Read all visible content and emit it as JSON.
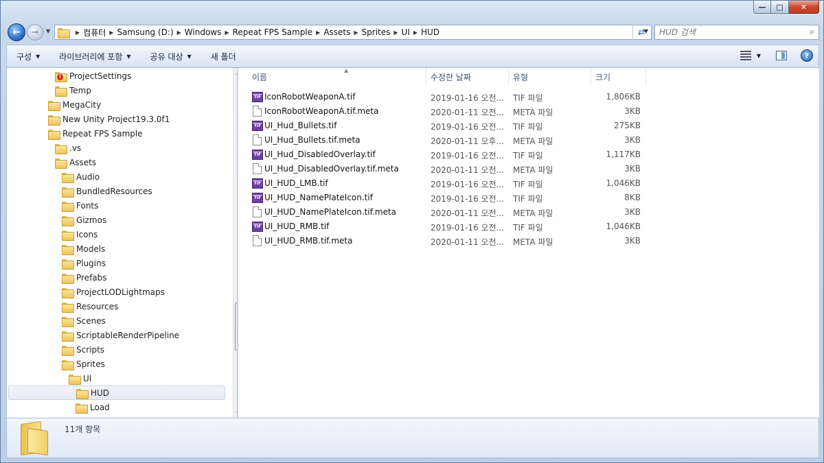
{
  "window": {
    "minimize": "—",
    "maximize": "□",
    "close": "✕"
  },
  "address": {
    "crumbs": [
      "컴퓨터",
      "Samsung (D:)",
      "Windows",
      "Repeat FPS Sample",
      "Assets",
      "Sprites",
      "UI",
      "HUD"
    ]
  },
  "search": {
    "placeholder": "HUD 검색"
  },
  "toolbar": {
    "organize": "구성",
    "include_library": "라이브러리에 포함",
    "share_with": "공유 대상",
    "new_folder": "새 폴더"
  },
  "tree": [
    {
      "label": "ProjectSettings",
      "indent": 2,
      "warn": true
    },
    {
      "label": "Temp",
      "indent": 2
    },
    {
      "label": "MegaCity",
      "indent": 1
    },
    {
      "label": "New Unity Project19.3.0f1",
      "indent": 1
    },
    {
      "label": "Repeat FPS Sample",
      "indent": 1
    },
    {
      "label": ".vs",
      "indent": 2
    },
    {
      "label": "Assets",
      "indent": 2
    },
    {
      "label": "Audio",
      "indent": 3
    },
    {
      "label": "BundledResources",
      "indent": 3
    },
    {
      "label": "Fonts",
      "indent": 3
    },
    {
      "label": "Gizmos",
      "indent": 3
    },
    {
      "label": "Icons",
      "indent": 3
    },
    {
      "label": "Models",
      "indent": 3
    },
    {
      "label": "Plugins",
      "indent": 3
    },
    {
      "label": "Prefabs",
      "indent": 3
    },
    {
      "label": "ProjectLODLightmaps",
      "indent": 3
    },
    {
      "label": "Resources",
      "indent": 3
    },
    {
      "label": "Scenes",
      "indent": 3
    },
    {
      "label": "ScriptableRenderPipeline",
      "indent": 3
    },
    {
      "label": "Scripts",
      "indent": 3
    },
    {
      "label": "Sprites",
      "indent": 3
    },
    {
      "label": "UI",
      "indent": 4
    },
    {
      "label": "HUD",
      "indent": 5,
      "selected": true
    },
    {
      "label": "Load",
      "indent": 5
    }
  ],
  "columns": {
    "name": "이름",
    "modified": "수정한 날짜",
    "type": "유형",
    "size": "크기"
  },
  "files": [
    {
      "name": "IconRobotWeaponA.tif",
      "date": "2019-01-16 오전...",
      "type": "TIF 파일",
      "size": "1,806KB",
      "icon": "tif"
    },
    {
      "name": "IconRobotWeaponA.tif.meta",
      "date": "2020-01-11 오전...",
      "type": "META 파일",
      "size": "3KB",
      "icon": "meta"
    },
    {
      "name": "UI_Hud_Bullets.tif",
      "date": "2019-01-16 오전...",
      "type": "TIF 파일",
      "size": "275KB",
      "icon": "tif"
    },
    {
      "name": "UI_Hud_Bullets.tif.meta",
      "date": "2020-01-11 오후...",
      "type": "META 파일",
      "size": "3KB",
      "icon": "meta"
    },
    {
      "name": "UI_Hud_DisabledOverlay.tif",
      "date": "2019-01-16 오전...",
      "type": "TIF 파일",
      "size": "1,117KB",
      "icon": "tif"
    },
    {
      "name": "UI_Hud_DisabledOverlay.tif.meta",
      "date": "2020-01-11 오전...",
      "type": "META 파일",
      "size": "3KB",
      "icon": "meta"
    },
    {
      "name": "UI_HUD_LMB.tif",
      "date": "2019-01-16 오전...",
      "type": "TIF 파일",
      "size": "1,046KB",
      "icon": "tif"
    },
    {
      "name": "UI_HUD_NamePlateIcon.tif",
      "date": "2019-01-16 오전...",
      "type": "TIF 파일",
      "size": "8KB",
      "icon": "tif"
    },
    {
      "name": "UI_HUD_NamePlateIcon.tif.meta",
      "date": "2020-01-11 오전...",
      "type": "META 파일",
      "size": "3KB",
      "icon": "meta"
    },
    {
      "name": "UI_HUD_RMB.tif",
      "date": "2019-01-16 오전...",
      "type": "TIF 파일",
      "size": "1,046KB",
      "icon": "tif"
    },
    {
      "name": "UI_HUD_RMB.tif.meta",
      "date": "2020-01-11 오전...",
      "type": "META 파일",
      "size": "3KB",
      "icon": "meta"
    }
  ],
  "status": {
    "item_count": "11개 항목"
  },
  "icons": {
    "tif_label": "TIF",
    "back": "back-arrow-icon",
    "forward": "forward-arrow-icon",
    "search": "search-icon",
    "help": "?"
  }
}
